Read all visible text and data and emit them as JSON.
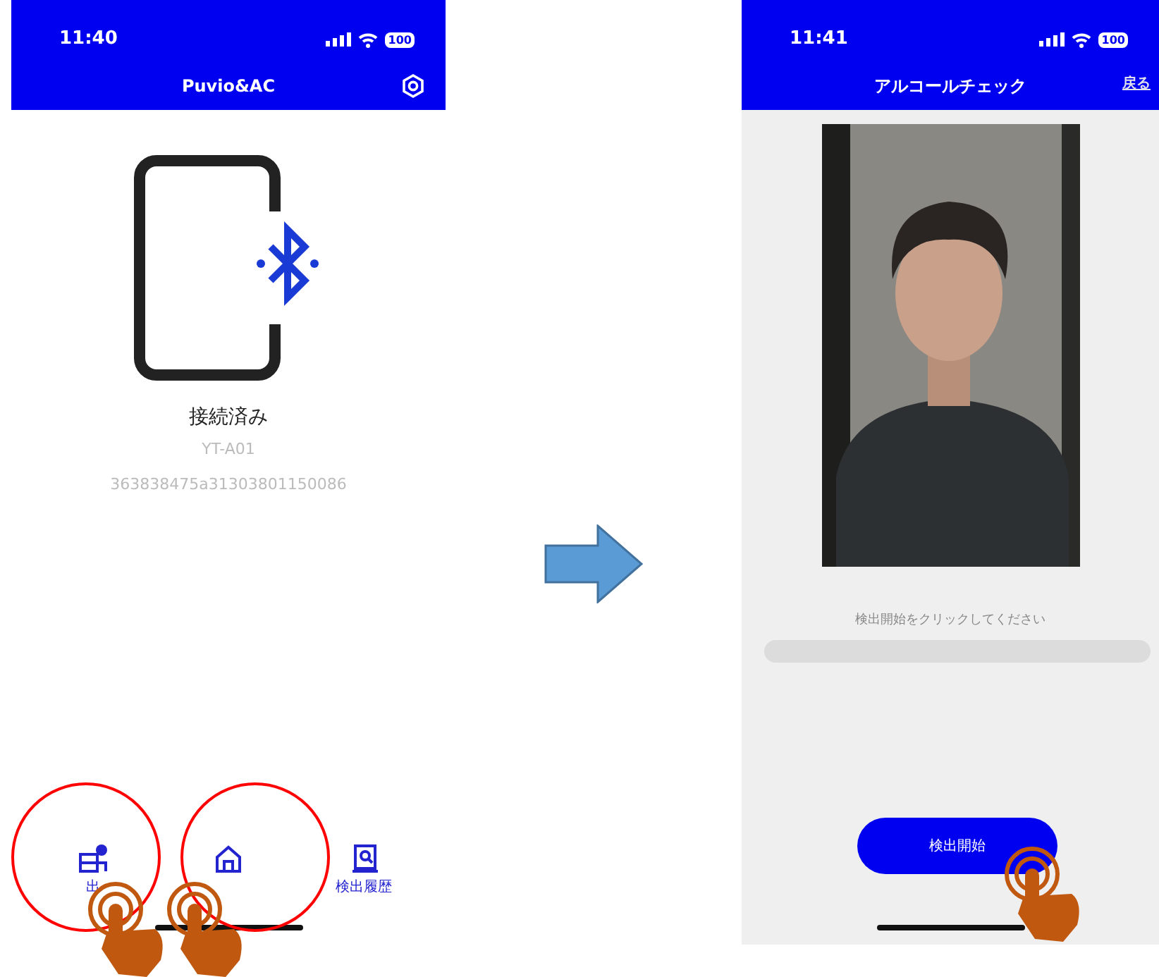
{
  "left_screen": {
    "status_bar": {
      "time": "11:40",
      "battery": "100"
    },
    "title": "Puvio&AC",
    "device": {
      "status": "接続済み",
      "name": "YT-A01",
      "id": "363838475a31303801150086"
    },
    "tabs": [
      {
        "kind": "commute",
        "label": "出",
        "circled": true
      },
      {
        "kind": "home",
        "circled": true
      },
      {
        "kind": "history",
        "label": "検出履歴",
        "circled": false
      }
    ]
  },
  "right_screen": {
    "status_bar": {
      "time": "11:41",
      "battery": "100"
    },
    "title": "アルコールチェック",
    "back": "戻る",
    "message": "検出開始をクリックしてください",
    "button": {
      "label": "検出開始",
      "tapped": true
    }
  }
}
